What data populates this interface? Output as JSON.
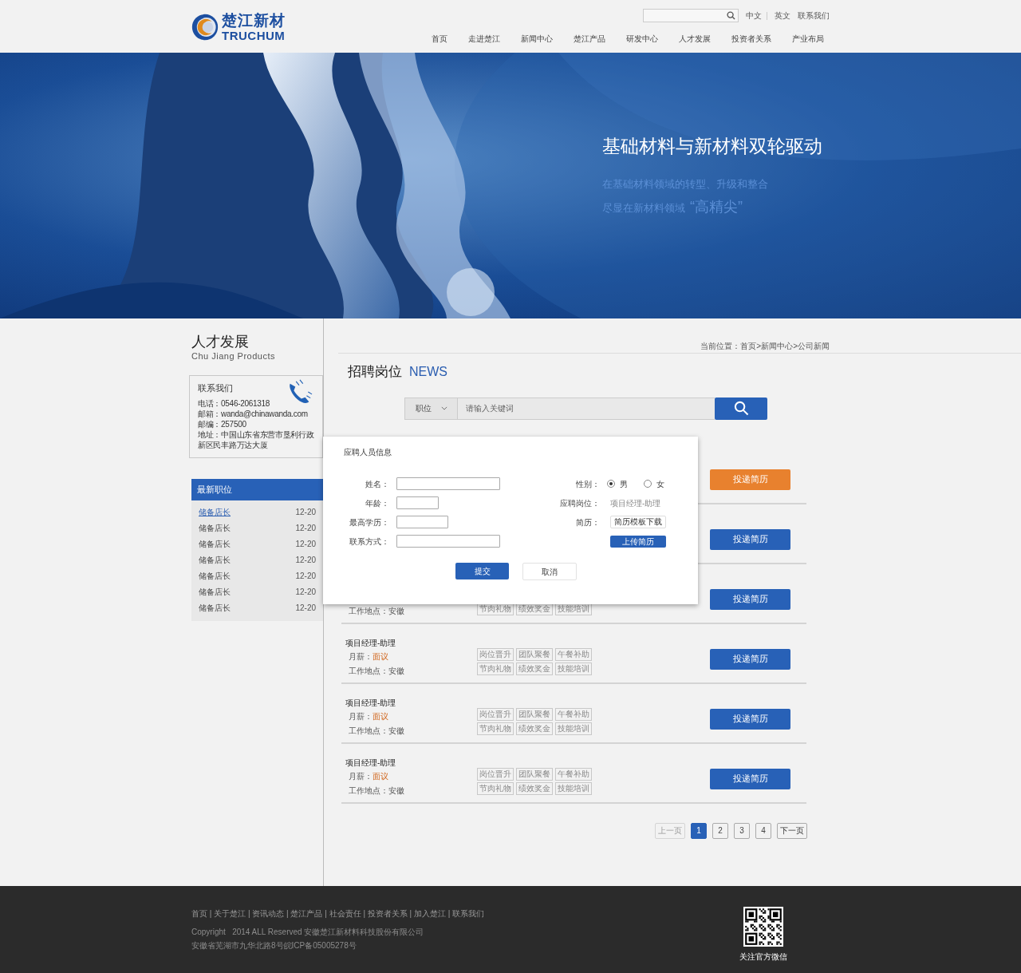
{
  "header": {
    "logo": {
      "name": "楚江新材",
      "latin": "TRUCHUM"
    },
    "languages": [
      {
        "label": "中文"
      },
      {
        "label": "英文"
      },
      {
        "label": "联系我们"
      }
    ],
    "nav": [
      {
        "label": "首页",
        "selected": false
      },
      {
        "label": "走进楚江",
        "selected": false
      },
      {
        "label": "新闻中心",
        "selected": false
      },
      {
        "label": "楚江产品",
        "selected": false
      },
      {
        "label": "研发中心",
        "selected": false
      },
      {
        "label": "人才发展",
        "selected": false
      },
      {
        "label": "投资者关系",
        "selected": false
      },
      {
        "label": "产业布局",
        "selected": false
      }
    ]
  },
  "banner": {
    "headline": "基础材料与新材料双轮驱动",
    "line1": "在基础材料领域的转型、升级和整合",
    "line2": "尽显在新材料领域",
    "line2_highlight": "“高精尖”"
  },
  "sidebar": {
    "title": "人才发展",
    "subtitle": "Chu Jiang Products",
    "contact": {
      "title": "联系我们",
      "lines": [
        "电话：0546-2061318",
        "邮箱：wanda@chinawanda.com",
        "邮编：257500",
        "地址：中国山东省东营市垦利行政新区民丰路万达大厦"
      ]
    },
    "latest_jobs": {
      "title": "最新职位",
      "items": [
        {
          "name": "储备店长",
          "date": "12-20",
          "selected": true
        },
        {
          "name": "储备店长",
          "date": "12-20",
          "selected": false
        },
        {
          "name": "储备店长",
          "date": "12-20",
          "selected": false
        },
        {
          "name": "储备店长",
          "date": "12-20",
          "selected": false
        },
        {
          "name": "储备店长",
          "date": "12-20",
          "selected": false
        },
        {
          "name": "储备店长",
          "date": "12-20",
          "selected": false
        },
        {
          "name": "储备店长",
          "date": "12-20",
          "selected": false
        }
      ]
    }
  },
  "breadcrumb": "当前位置：首页>新闻中心>公司新闻",
  "section": {
    "title": "招聘岗位",
    "title_en": "NEWS"
  },
  "search": {
    "category": "职位",
    "placeholder": "请输入关键词"
  },
  "jobs": [
    {
      "button": "投递简历",
      "highlighted": true
    },
    {
      "button": "投递简历",
      "highlighted": false
    },
    {
      "location": "工作地点：安徽",
      "tags_row2": [
        "节肉礼物",
        "绩效奖金",
        "技能培训"
      ],
      "button": "投递简历",
      "highlighted": false
    },
    {
      "title": "项目经理-助理",
      "salary_label": "月薪：",
      "salary": "面议",
      "location": "工作地点：安徽",
      "tags_row1": [
        "岗位晋升",
        "团队聚餐",
        "午餐补助"
      ],
      "tags_row2": [
        "节肉礼物",
        "绩效奖金",
        "技能培训"
      ],
      "button": "投递简历",
      "highlighted": false
    },
    {
      "title": "项目经理-助理",
      "salary_label": "月薪：",
      "salary": "面议",
      "location": "工作地点：安徽",
      "tags_row1": [
        "岗位晋升",
        "团队聚餐",
        "午餐补助"
      ],
      "tags_row2": [
        "节肉礼物",
        "绩效奖金",
        "技能培训"
      ],
      "button": "投递简历",
      "highlighted": false
    },
    {
      "title": "项目经理-助理",
      "salary_label": "月薪：",
      "salary": "面议",
      "location": "工作地点：安徽",
      "tags_row1": [
        "岗位晋升",
        "团队聚餐",
        "午餐补助"
      ],
      "tags_row2": [
        "节肉礼物",
        "绩效奖金",
        "技能培训"
      ],
      "button": "投递简历",
      "highlighted": false
    }
  ],
  "pagination": {
    "prev": {
      "label": "上一页",
      "disabled": true
    },
    "pages": [
      {
        "label": "1",
        "selected": true
      },
      {
        "label": "2",
        "selected": false
      },
      {
        "label": "3",
        "selected": false
      },
      {
        "label": "4",
        "selected": false
      }
    ],
    "next": {
      "label": "下一页",
      "disabled": false
    }
  },
  "dialog": {
    "title": "应聘人员信息",
    "fields": [
      {
        "label": "姓名："
      },
      {
        "label": "年龄："
      },
      {
        "label": "最高学历："
      },
      {
        "label": "联系方式："
      }
    ],
    "gender": {
      "label": "性别：",
      "options": [
        {
          "label": "男",
          "selected": true
        },
        {
          "label": "女",
          "selected": false
        }
      ]
    },
    "position": {
      "label": "应聘岗位：",
      "value": "项目经理-助理"
    },
    "resume": {
      "label": "简历：",
      "download": "简历模板下载",
      "upload": "上传简历"
    },
    "submit": "提交",
    "cancel": "取消"
  },
  "footer": {
    "links": "首页 | 关于楚江 | 资讯动态 | 楚江产品 | 社会责任 | 投资者关系 | 加入楚江 | 联系我们",
    "copyright": "Copyright   2014 ALL Reserved 安徽楚江新材料科技股份有限公司",
    "icp": "安徽省芜湖市九华北路8号皖ICP备05005278号",
    "qr_caption": "关注官方微信"
  }
}
